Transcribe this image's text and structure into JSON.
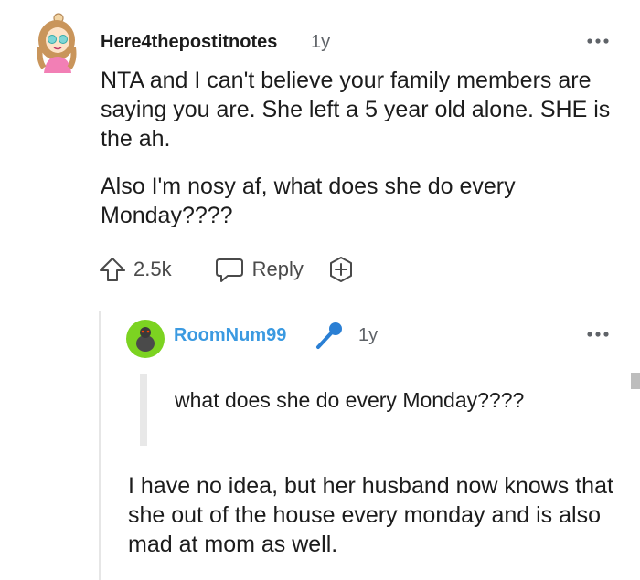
{
  "comment": {
    "username": "Here4thepostitnotes",
    "age": "1y",
    "paragraphs": [
      "NTA and I can't believe your family members are saying you are. She left a 5 year old alone. SHE is the ah.",
      "Also I'm nosy af, what does she do every Monday????"
    ],
    "actions": {
      "upvotes": "2.5k",
      "reply_label": "Reply"
    }
  },
  "reply": {
    "username": "RoomNum99",
    "age": "1y",
    "quote": "what does she do every Monday????",
    "body": "I have no idea, but her husband now knows that she out of the house every monday and is also mad at mom as well."
  },
  "icons": {
    "more": "more-horizontal-icon",
    "upvote": "upvote-arrow-icon",
    "reply": "speech-bubble-icon",
    "award": "award-plus-icon",
    "mic": "microphone-icon"
  },
  "colors": {
    "username_reply": "#3b9ae1",
    "text": "#1c1c1c",
    "muted": "#5f6368"
  }
}
